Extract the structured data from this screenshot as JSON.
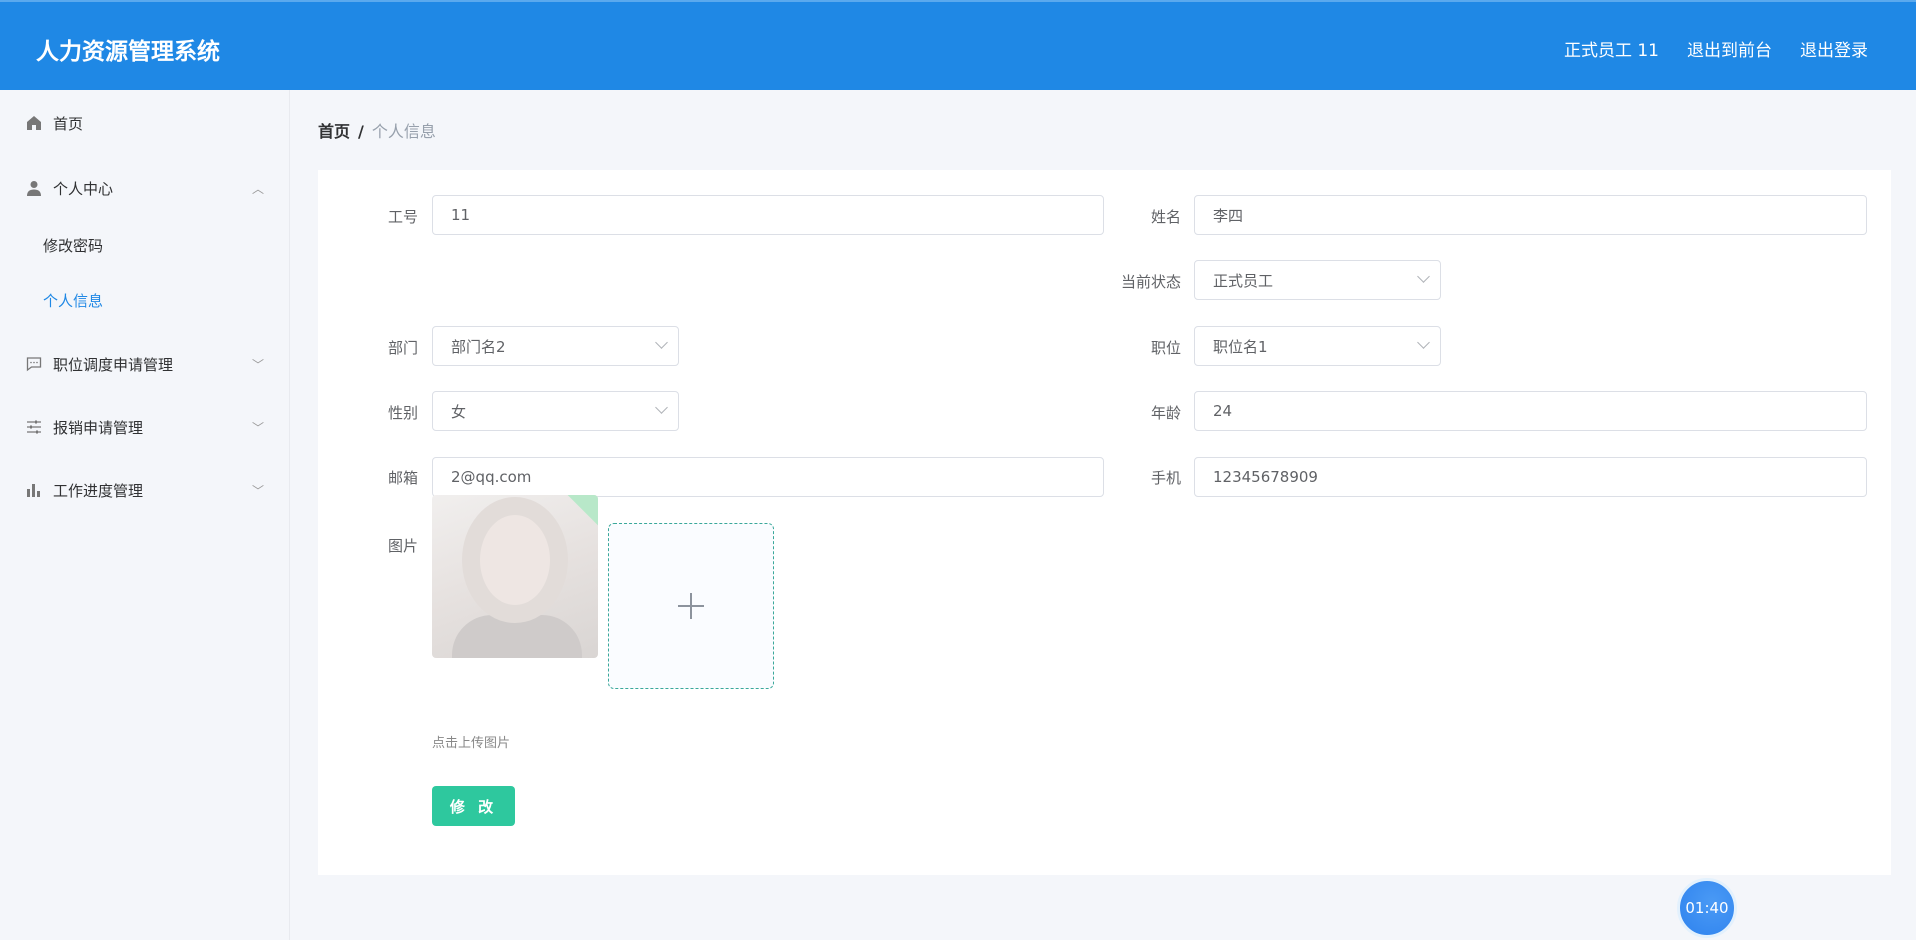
{
  "header": {
    "title": "人力资源管理系统",
    "user": "正式员工 11",
    "to_front": "退出到前台",
    "logout": "退出登录"
  },
  "sidebar": {
    "items": [
      {
        "label": "首页",
        "icon": "home-icon"
      },
      {
        "label": "个人中心",
        "icon": "user-icon"
      },
      {
        "label": "修改密码"
      },
      {
        "label": "个人信息"
      },
      {
        "label": "职位调度申请管理",
        "icon": "chat-icon"
      },
      {
        "label": "报销申请管理",
        "icon": "sliders-icon"
      },
      {
        "label": "工作进度管理",
        "icon": "bar-chart-icon"
      }
    ]
  },
  "breadcrumb": {
    "home": "首页",
    "sep": "/",
    "current": "个人信息"
  },
  "form": {
    "emp_no": {
      "label": "工号",
      "value": "11"
    },
    "name": {
      "label": "姓名",
      "value": "李四"
    },
    "status": {
      "label": "当前状态",
      "value": "正式员工"
    },
    "dept": {
      "label": "部门",
      "value": "部门名2"
    },
    "position": {
      "label": "职位",
      "value": "职位名1"
    },
    "gender": {
      "label": "性别",
      "value": "女"
    },
    "age": {
      "label": "年龄",
      "value": "24"
    },
    "email": {
      "label": "邮箱",
      "value": "2@qq.com"
    },
    "phone": {
      "label": "手机",
      "value": "12345678909"
    },
    "picture": {
      "label": "图片",
      "hint": "点击上传图片"
    },
    "submit": "修 改"
  },
  "timer": "01:40",
  "colors": {
    "header": "#1f88e5",
    "button": "#2ec89e",
    "active": "#1f88e5"
  }
}
